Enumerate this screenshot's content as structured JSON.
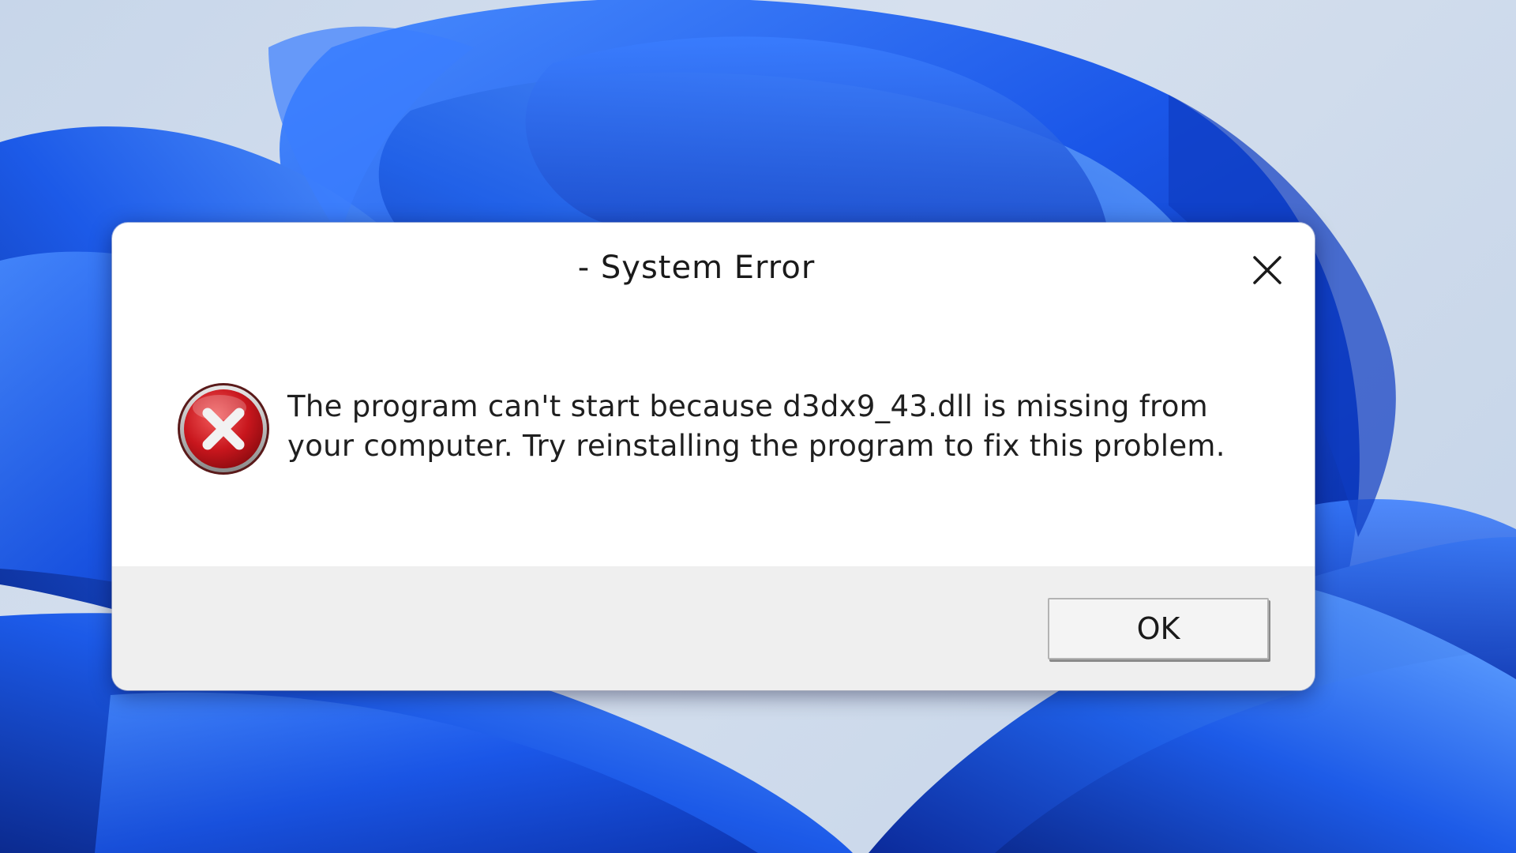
{
  "dialog": {
    "title": "- System Error",
    "message": "The program can't start because d3dx9_43.dll is missing from your computer. Try reinstalling the program to fix this problem.",
    "icon": "error-icon",
    "close_icon": "close-icon",
    "ok_label": "OK"
  },
  "colors": {
    "desktop_blue": "#1f5fe0",
    "error_red": "#c8161d",
    "dialog_bg": "#ffffff",
    "footer_bg": "#efefef"
  }
}
